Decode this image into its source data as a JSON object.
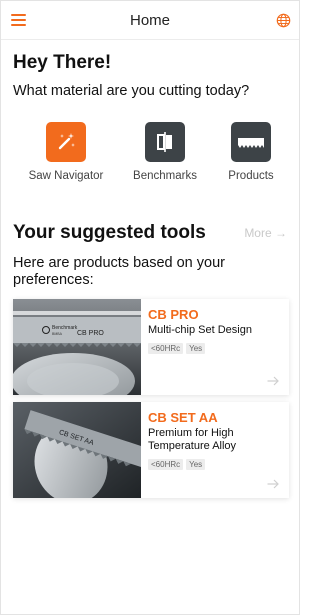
{
  "header": {
    "title": "Home",
    "menu_icon": "hamburger-menu-icon",
    "lang_icon": "globe-icon"
  },
  "greeting": {
    "title": "Hey There!",
    "question": "What material are you cutting today?"
  },
  "quick_actions": [
    {
      "label": "Saw Navigator",
      "icon": "magic-wand-icon"
    },
    {
      "label": "Benchmarks",
      "icon": "compare-icon"
    },
    {
      "label": "Products",
      "icon": "saw-blade-icon"
    }
  ],
  "suggested": {
    "title": "Your suggested tools",
    "more_label": "More",
    "subtitle": "Here are products based on your preferences:"
  },
  "products": [
    {
      "name": "CB PRO",
      "description": "Multi-chip Set Design",
      "tags": [
        "<60HRc",
        "Yes"
      ],
      "image_label": "CB PRO",
      "brand": "Benchmark"
    },
    {
      "name": "CB SET AA",
      "description": "Premium for High Temperature Alloy",
      "tags": [
        "<60HRc",
        "Yes"
      ],
      "image_label": "CB SET AA"
    }
  ],
  "colors": {
    "accent": "#f26b1d",
    "dark_tile": "#3d4347",
    "muted": "#c9c9c9"
  }
}
